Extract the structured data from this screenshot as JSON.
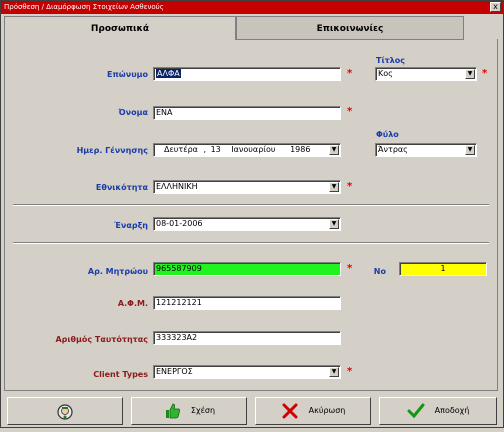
{
  "window": {
    "title": "Πρόσθεση / Διαμόρφωση Στοιχείων Ασθενούς",
    "close_glyph": "x"
  },
  "tabs": [
    {
      "label": "Προσωπικά",
      "active": true
    },
    {
      "label": "Επικοινωνίες",
      "active": false
    }
  ],
  "form": {
    "eponymo": {
      "label": "Επώνυμο",
      "value": "ΑΛΦΑ",
      "required": "*"
    },
    "titlos": {
      "label": "Τίτλος",
      "value": "Κος",
      "required": "*"
    },
    "onoma": {
      "label": "Όνομα",
      "value": "ΕΝΑ",
      "required": "*"
    },
    "genisi": {
      "label": "Ημερ. Γέννησης",
      "day": "Δευτέρα",
      "date": "13",
      "month": "Ιανουαρίου",
      "year": "1986"
    },
    "fylo": {
      "label": "Φύλο",
      "value": "Άντρας"
    },
    "ethnikotita": {
      "label": "Εθνικότητα",
      "value": "ΕΛΛΗΝΙΚΗ",
      "required": "*"
    },
    "enarxi": {
      "label": "Έναρξη",
      "value": "08-01-2006"
    },
    "mitroo": {
      "label": "Αρ. Μητρώου",
      "value": "965587909",
      "required": "*"
    },
    "no": {
      "label": "No",
      "value": "1"
    },
    "afm": {
      "label": "Α.Φ.Μ.",
      "value": "121212121"
    },
    "taftotita": {
      "label": "Αριθμός Ταυτότητας",
      "value": "333323Α2"
    },
    "client_types": {
      "label": "Client Types",
      "value": "ΕΝΕΡΓΟΣ",
      "required": "*"
    }
  },
  "buttons": {
    "icon_button": {
      "icon": "doctor-icon"
    },
    "relation": {
      "label": "Σχέση",
      "icon": "thumbs-up-icon"
    },
    "cancel": {
      "label": "Ακύρωση",
      "icon": "red-x-icon"
    },
    "accept": {
      "label": "Αποδοχή",
      "icon": "check-icon"
    }
  },
  "colors": {
    "title_bar": "#c40000",
    "highlight_green": "#21f321",
    "highlight_yellow": "#ffff00",
    "label_blue": "#1a3ca8",
    "label_darkred": "#8b1a1a"
  }
}
